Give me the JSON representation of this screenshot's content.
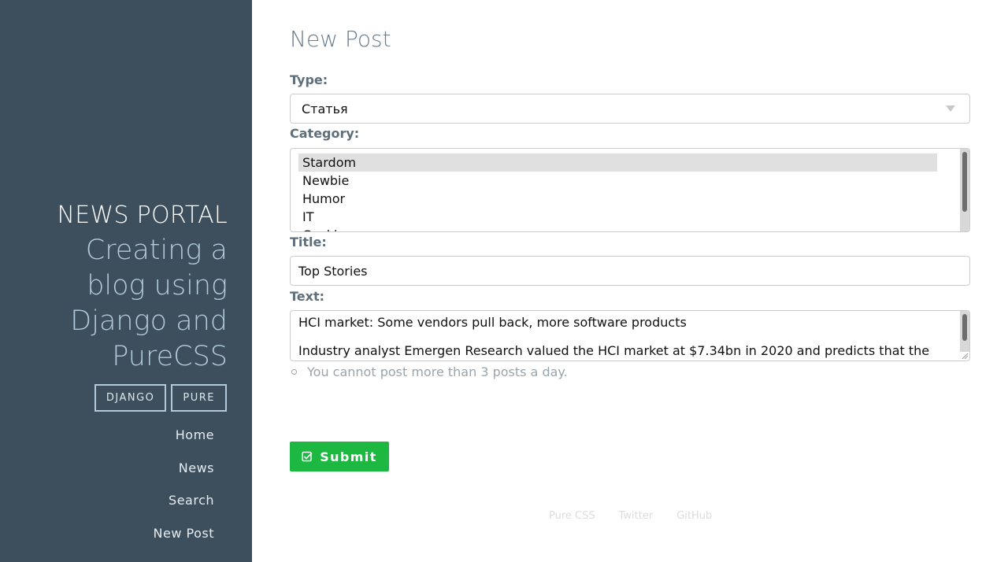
{
  "sidebar": {
    "brand_title": "NEWS PORTAL",
    "tagline": "Creating a blog using Django and PureCSS",
    "tags": [
      "DJANGO",
      "PURE"
    ],
    "nav": [
      "Home",
      "News",
      "Search",
      "New Post"
    ]
  },
  "form": {
    "page_title": "New Post",
    "type_label": "Type:",
    "type_value": "Статья",
    "category_label": "Category:",
    "category_options": [
      "Stardom",
      "Newbie",
      "Humor",
      "IT",
      "Cooking"
    ],
    "category_selected": "Stardom",
    "title_label": "Title:",
    "title_value": "Top Stories",
    "text_label": "Text:",
    "text_line1": "HCI market: Some vendors pull back, more software products",
    "text_line2": "Industry analyst Emergen Research valued the HCI market at $7.34bn in 2020 and predicts that the",
    "error": "You cannot post more than 3 posts a day.",
    "submit_label": "Submit"
  },
  "footer": {
    "links": [
      "Pure CSS",
      "Twitter",
      "GitHub"
    ]
  },
  "colors": {
    "sidebar_bg": "#3d4f5d",
    "accent_green": "#1cb841",
    "tagline": "#b0cadb"
  }
}
